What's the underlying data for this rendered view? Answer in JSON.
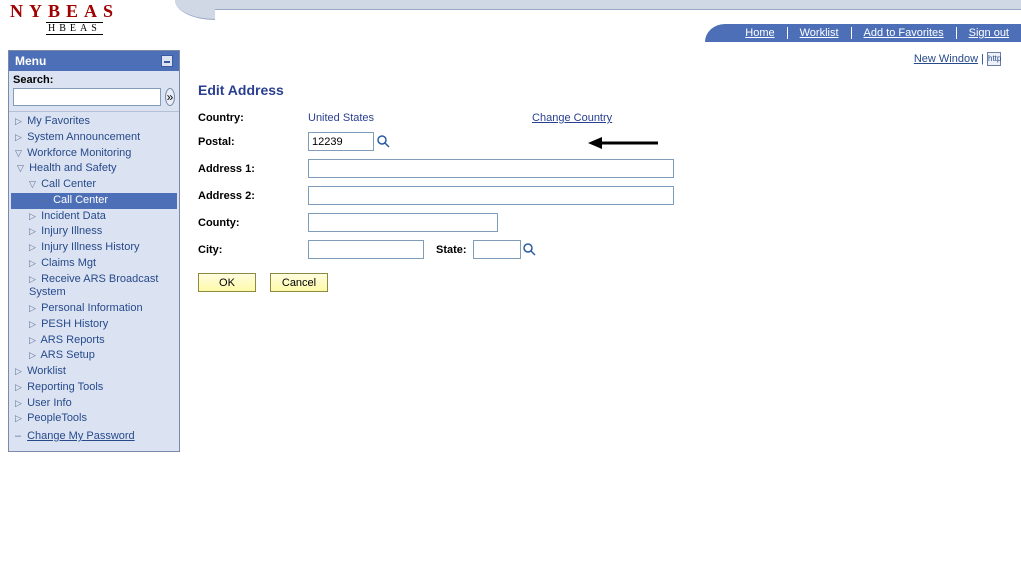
{
  "header": {
    "logo_top": "NYBEAS",
    "logo_sub": "HBEAS",
    "nav": {
      "home": "Home",
      "worklist": "Worklist",
      "favorites": "Add to Favorites",
      "signout": "Sign out"
    }
  },
  "topright": {
    "new_window": "New Window",
    "help_alt": "http"
  },
  "sidebar": {
    "menu_title": "Menu",
    "search_label": "Search:",
    "search_value": "",
    "items": {
      "favorites": "My Favorites",
      "sys_announce": "System Announcement",
      "workforce": "Workforce Monitoring",
      "health_safety": "Health and Safety",
      "call_center_folder": "Call Center",
      "call_center": "Call Center",
      "incident_data": "Incident Data",
      "injury_illness": "Injury Illness",
      "injury_history": "Injury Illness History",
      "claims_mgt": "Claims Mgt",
      "receive_ars": "Receive ARS Broadcast System",
      "personal_info": "Personal Information",
      "pesh_history": "PESH History",
      "ars_reports": "ARS Reports",
      "ars_setup": "ARS Setup",
      "worklist": "Worklist",
      "reporting": "Reporting Tools",
      "user_info": "User Info",
      "peopletools": "PeopleTools",
      "change_pw": "Change My Password"
    }
  },
  "page": {
    "title": "Edit Address",
    "labels": {
      "country": "Country:",
      "postal": "Postal:",
      "address1": "Address 1:",
      "address2": "Address 2:",
      "county": "County:",
      "city": "City:",
      "state": "State:"
    },
    "values": {
      "country": "United States",
      "change_country": "Change Country",
      "postal": "12239",
      "address1": "",
      "address2": "",
      "county": "",
      "city": "",
      "state": ""
    },
    "buttons": {
      "ok": "OK",
      "cancel": "Cancel"
    }
  }
}
